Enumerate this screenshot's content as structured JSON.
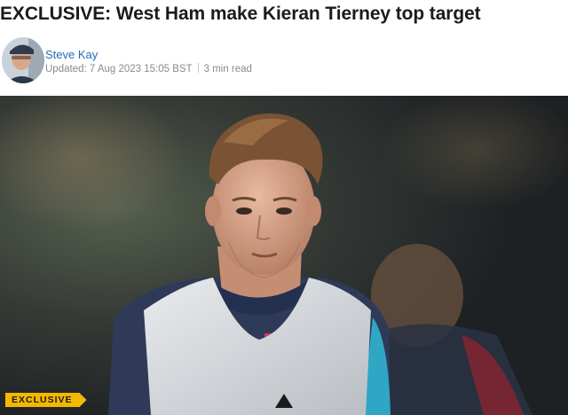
{
  "article": {
    "headline": "EXCLUSIVE: West Ham make Kieran Tierney top target",
    "author": "Steve Kay",
    "updated": "Updated: 7 Aug 2023 15:05 BST",
    "read_time": "3 min read"
  },
  "hero": {
    "badge": "EXCLUSIVE"
  },
  "colors": {
    "author_link": "#1a6fb5",
    "badge": "#f5b800",
    "headline": "#1b1b1b"
  }
}
